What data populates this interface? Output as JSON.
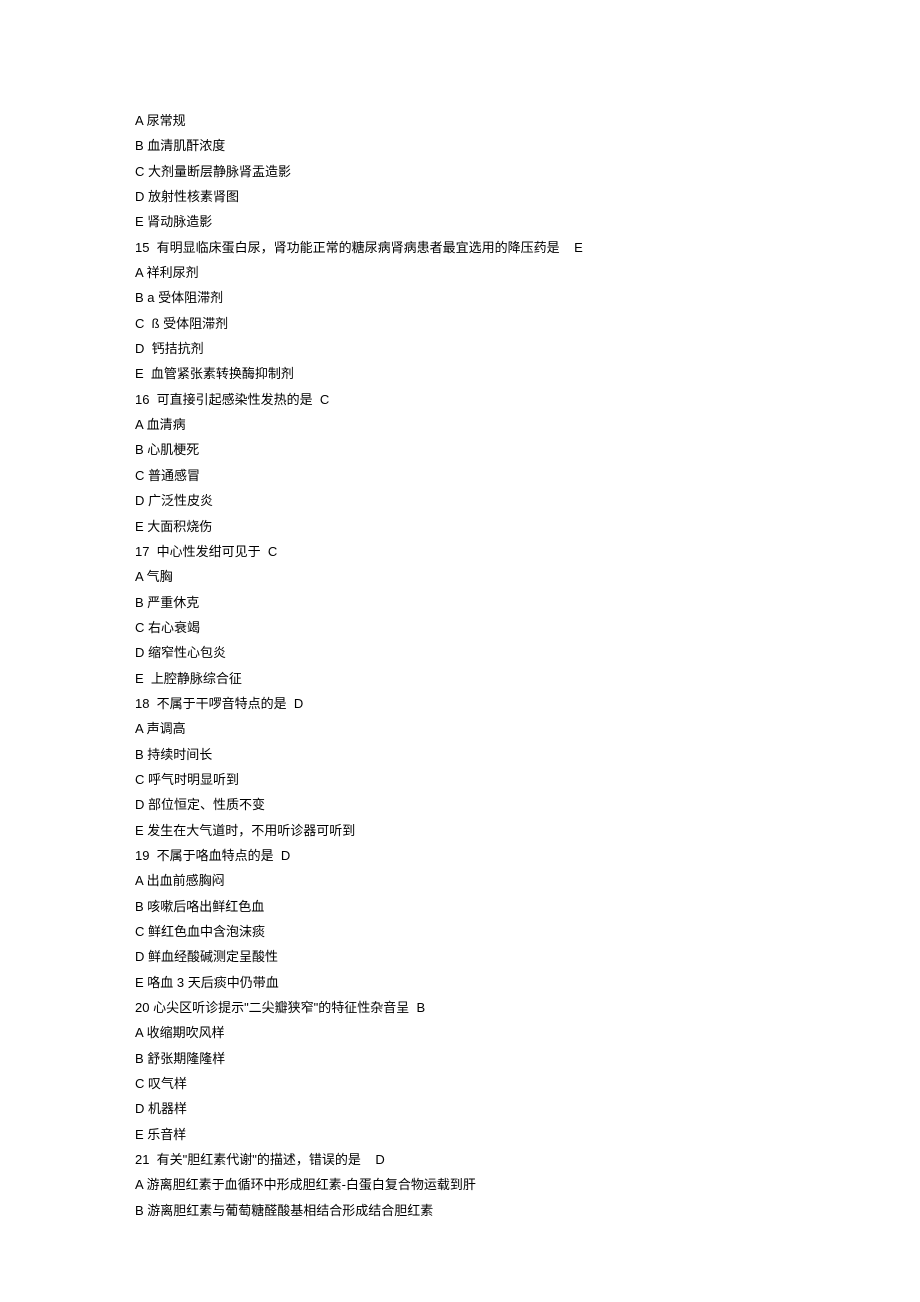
{
  "lines": [
    "A 尿常规",
    "B 血清肌酐浓度",
    "C 大剂量断层静脉肾盂造影",
    "D 放射性核素肾图",
    "E 肾动脉造影",
    "15  有明显临床蛋白尿，肾功能正常的糖尿病肾病患者最宜选用的降压药是    E",
    "A 祥利尿剂",
    "B a 受体阻滞剂",
    "C  ß 受体阻滞剂",
    "D  钙拮抗剂",
    "E  血管紧张素转换酶抑制剂",
    "16  可直接引起感染性发热的是  C",
    "A 血清病",
    "B 心肌梗死",
    "C 普通感冒",
    "D 广泛性皮炎",
    "E 大面积烧伤",
    "17  中心性发绀可见于  C",
    "A 气胸",
    "B 严重休克",
    "C 右心衰竭",
    "D 缩窄性心包炎",
    "E  上腔静脉综合征",
    "18  不属于干啰音特点的是  D",
    "A 声调高",
    "B 持续时间长",
    "C 呼气时明显听到",
    "D 部位恒定、性质不变",
    "E 发生在大气道时，不用听诊器可听到",
    "19  不属于咯血特点的是  D",
    "A 出血前感胸闷",
    "B 咳嗽后咯出鲜红色血",
    "C 鲜红色血中含泡沫痰",
    "D 鲜血经酸碱测定呈酸性",
    "E 咯血 3 天后痰中仍带血",
    "20 心尖区听诊提示\"二尖瓣狭窄\"的特征性杂音呈  B",
    "A 收缩期吹风样",
    "B 舒张期隆隆样",
    "C 叹气样",
    "D 机器样",
    "E 乐音样",
    "21  有关\"胆红素代谢\"的描述，错误的是    D",
    "A 游离胆红素于血循环中形成胆红素-白蛋白复合物运载到肝",
    "B 游离胆红素与葡萄糖醛酸基相结合形成结合胆红素"
  ]
}
